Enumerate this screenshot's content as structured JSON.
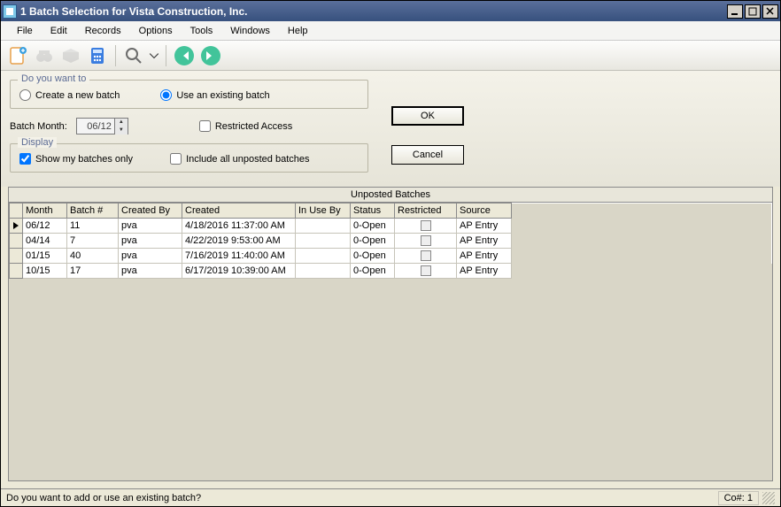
{
  "window": {
    "title": "1 Batch Selection for Vista Construction, Inc."
  },
  "menu": {
    "file": "File",
    "edit": "Edit",
    "records": "Records",
    "options": "Options",
    "tools": "Tools",
    "windows": "Windows",
    "help": "Help"
  },
  "fieldset1": {
    "legend": "Do you want to",
    "opt_new": "Create a new batch",
    "opt_existing": "Use an existing batch"
  },
  "batch_month": {
    "label": "Batch Month:",
    "value": "06/12"
  },
  "restricted": {
    "label": "Restricted Access"
  },
  "fieldset2": {
    "legend": "Display",
    "opt_mine": "Show my batches only",
    "opt_all": "Include all unposted batches"
  },
  "buttons": {
    "ok": "OK",
    "cancel": "Cancel"
  },
  "grid": {
    "title": "Unposted Batches",
    "headers": {
      "month": "Month",
      "batch": "Batch #",
      "createdby": "Created By",
      "created": "Created",
      "inuse": "In Use By",
      "status": "Status",
      "restricted": "Restricted",
      "source": "Source"
    },
    "rows": [
      {
        "month": "06/12",
        "batch": "11",
        "createdby": "pva",
        "created": "4/18/2016 11:37:00 AM",
        "inuse": "",
        "status": "0-Open",
        "restricted": false,
        "source": "AP Entry"
      },
      {
        "month": "04/14",
        "batch": "7",
        "createdby": "pva",
        "created": "4/22/2019 9:53:00 AM",
        "inuse": "",
        "status": "0-Open",
        "restricted": false,
        "source": "AP Entry"
      },
      {
        "month": "01/15",
        "batch": "40",
        "createdby": "pva",
        "created": "7/16/2019 11:40:00 AM",
        "inuse": "",
        "status": "0-Open",
        "restricted": false,
        "source": "AP Entry"
      },
      {
        "month": "10/15",
        "batch": "17",
        "createdby": "pva",
        "created": "6/17/2019 10:39:00 AM",
        "inuse": "",
        "status": "0-Open",
        "restricted": false,
        "source": "AP Entry"
      }
    ]
  },
  "status": {
    "prompt": "Do you want to add or use an existing batch?",
    "co": "Co#: 1"
  }
}
